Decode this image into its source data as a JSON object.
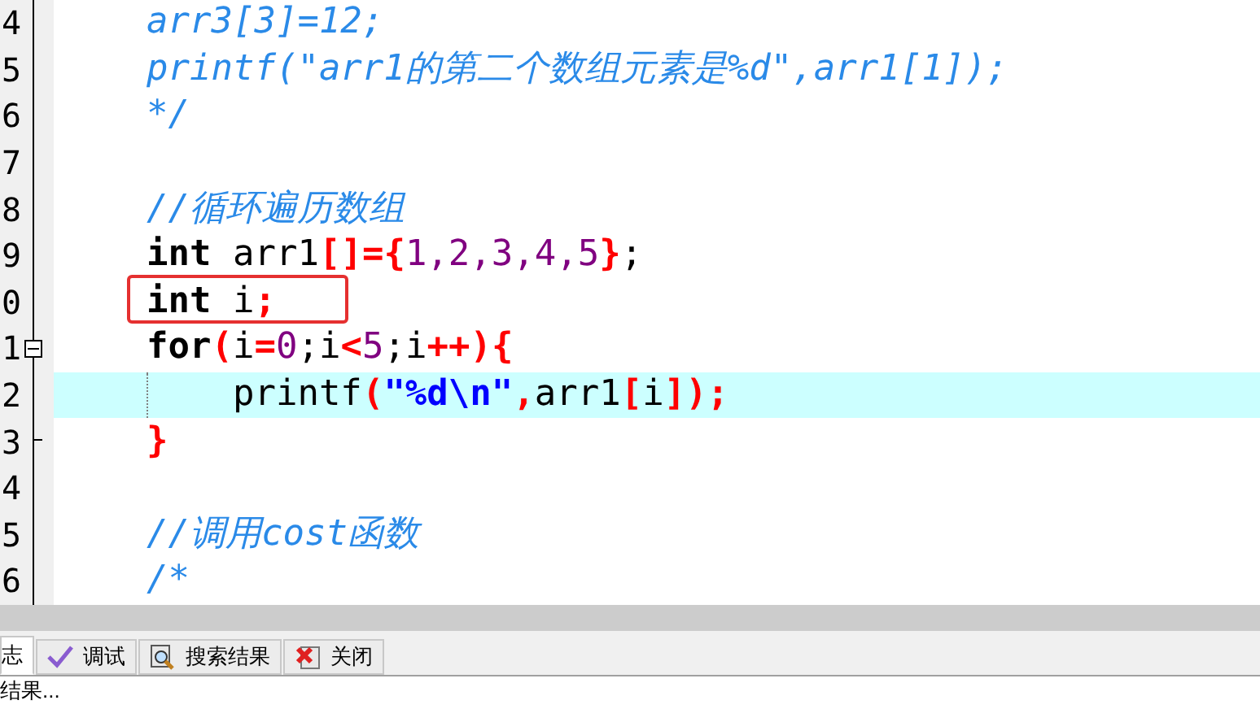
{
  "editor": {
    "lines": [
      {
        "number": "4",
        "kind": "plain",
        "current": false,
        "boxed": false,
        "tokens": [
          {
            "text": "    arr3[3]=12;",
            "kind": "comment"
          }
        ]
      },
      {
        "number": "5",
        "kind": "plain",
        "current": false,
        "boxed": false,
        "tokens": [
          {
            "text": "    printf(\"arr1的第二个数组元素是%d\",arr1[1]);",
            "kind": "comment"
          }
        ]
      },
      {
        "number": "6",
        "kind": "plain",
        "current": false,
        "boxed": false,
        "tokens": [
          {
            "text": "    */",
            "kind": "comment"
          }
        ]
      },
      {
        "number": "7",
        "kind": "plain",
        "current": false,
        "boxed": false
      },
      {
        "number": "8",
        "kind": "plain",
        "current": false,
        "boxed": false,
        "tokens": [
          {
            "text": "    //循环遍历数组",
            "kind": "comment"
          }
        ]
      },
      {
        "number": "9",
        "kind": "plain",
        "current": false,
        "boxed": false,
        "tokens": [
          {
            "text": "    int",
            "kind": "keyword"
          },
          {
            "text": " arr1",
            "kind": "plain"
          },
          {
            "text": "[]={",
            "kind": "operator"
          },
          {
            "text": "1,2,3,4,5",
            "kind": "number"
          },
          {
            "text": "}",
            "kind": "operator"
          },
          {
            "text": ";",
            "kind": "plain"
          }
        ]
      },
      {
        "number": "0",
        "kind": "plain",
        "current": false,
        "boxed": true,
        "tokens": [
          {
            "text": "    int",
            "kind": "keyword"
          },
          {
            "text": " i",
            "kind": "plain"
          },
          {
            "text": ";",
            "kind": "operator"
          }
        ]
      },
      {
        "number": "1",
        "kind": "foldstart",
        "current": false,
        "boxed": false,
        "tokens": [
          {
            "text": "    for",
            "kind": "keyword"
          },
          {
            "text": "(",
            "kind": "operator"
          },
          {
            "text": "i",
            "kind": "plain"
          },
          {
            "text": "=",
            "kind": "operator"
          },
          {
            "text": "0",
            "kind": "number"
          },
          {
            "text": ";i",
            "kind": "plain"
          },
          {
            "text": "<",
            "kind": "operator"
          },
          {
            "text": "5",
            "kind": "number"
          },
          {
            "text": ";i",
            "kind": "plain"
          },
          {
            "text": "++){",
            "kind": "operator"
          }
        ]
      },
      {
        "number": "2",
        "kind": "plain",
        "current": true,
        "boxed": false,
        "tokens": [
          {
            "text": "        printf",
            "kind": "plain"
          },
          {
            "text": "(",
            "kind": "operator"
          },
          {
            "text": "\"%d\\n\"",
            "kind": "string"
          },
          {
            "text": ",",
            "kind": "operator"
          },
          {
            "text": "arr1",
            "kind": "plain"
          },
          {
            "text": "[",
            "kind": "operator"
          },
          {
            "text": "i",
            "kind": "plain"
          },
          {
            "text": "]);",
            "kind": "operator"
          }
        ]
      },
      {
        "number": "3",
        "kind": "foldend",
        "current": false,
        "boxed": false,
        "tokens": [
          {
            "text": "    }",
            "kind": "operator"
          }
        ]
      },
      {
        "number": "4",
        "kind": "plain",
        "current": false,
        "boxed": false
      },
      {
        "number": "5",
        "kind": "plain",
        "current": false,
        "boxed": false,
        "tokens": [
          {
            "text": "    //调用cost函数",
            "kind": "comment"
          }
        ]
      },
      {
        "number": "6",
        "kind": "plain",
        "current": false,
        "boxed": false,
        "tokens": [
          {
            "text": "    /*",
            "kind": "comment"
          }
        ]
      }
    ]
  },
  "bottom_tabs": [
    {
      "label": "志",
      "selected": true
    },
    {
      "label": "调试",
      "selected": false
    },
    {
      "label": "搜索结果",
      "selected": false
    },
    {
      "label": "关闭",
      "selected": false
    }
  ],
  "output": {
    "text": "结果..."
  }
}
